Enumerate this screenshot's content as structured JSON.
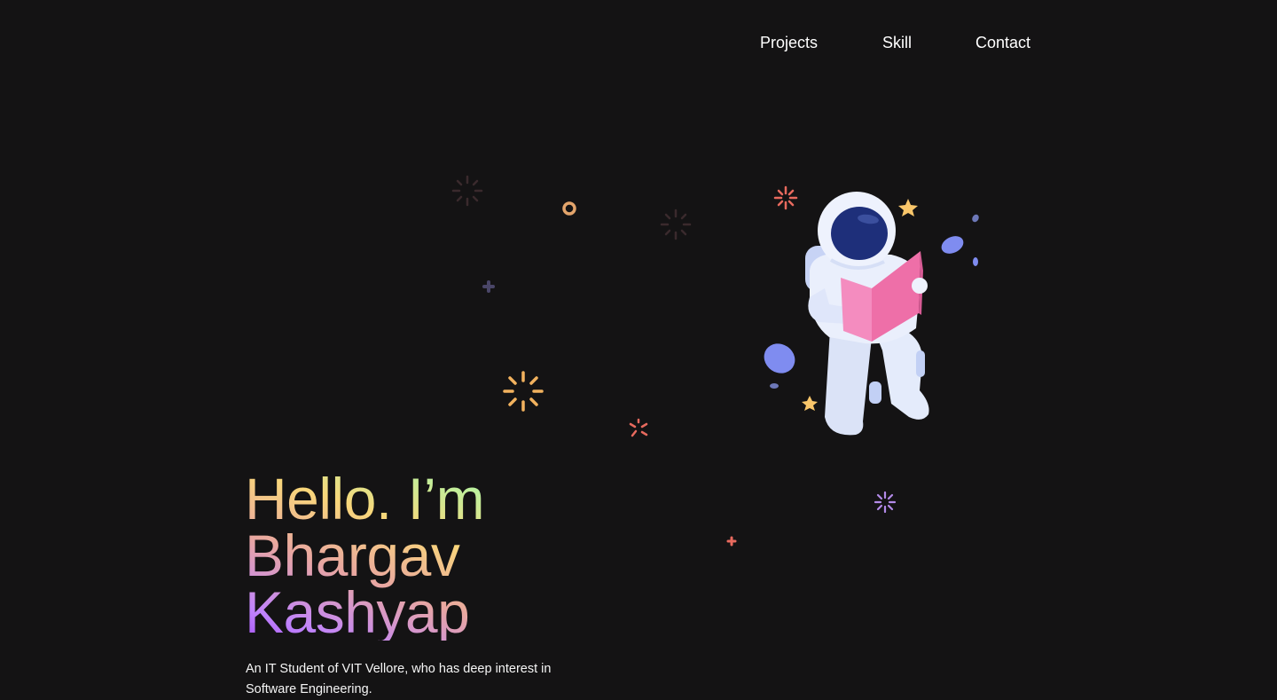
{
  "nav": {
    "items": [
      {
        "label": "Projects"
      },
      {
        "label": "Skill"
      },
      {
        "label": "Contact"
      }
    ]
  },
  "hero": {
    "title_lines": [
      "Hello. I’m",
      "Bhargav",
      "Kashyap"
    ],
    "tagline": "An IT Student of VIT Vellore, who has deep interest in Software Engineering."
  },
  "illustration": {
    "icon": "astronaut-reading-book-icon"
  },
  "colors": {
    "background": "#141314",
    "nav_text": "#ffffff",
    "astronaut_suit": "#e4ebfb",
    "visor": "#1e2f7a",
    "book": "#f07ab0",
    "star": "#f9c66a",
    "rock": "#7f8cf0"
  }
}
